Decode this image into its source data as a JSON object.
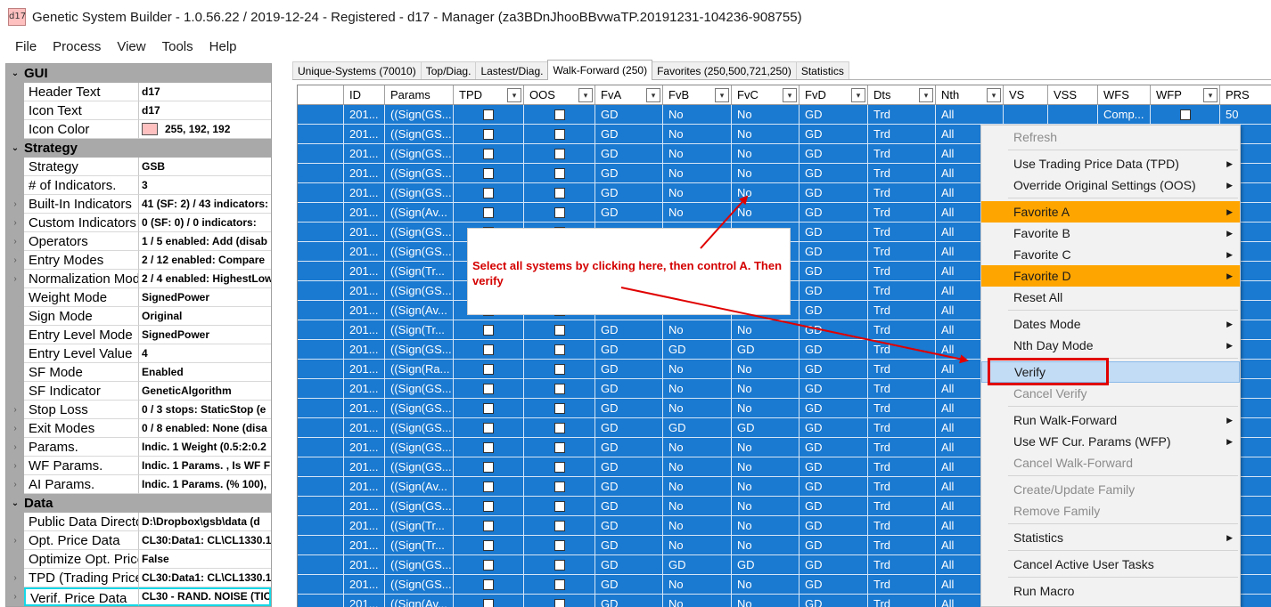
{
  "window": {
    "icon_text": "d17",
    "title": "Genetic System Builder - 1.0.56.22 / 2019-12-24 - Registered - d17 - Manager (za3BDnJhooBBvwaTP.20191231-104236-908755)"
  },
  "menubar": [
    "File",
    "Process",
    "View",
    "Tools",
    "Help"
  ],
  "propgrid": {
    "sections": [
      {
        "title": "GUI",
        "rows": [
          {
            "name": "Header Text",
            "value": "d17"
          },
          {
            "name": "Icon Text",
            "value": "d17"
          },
          {
            "name": "Icon Color",
            "value": "255, 192, 192",
            "swatch": "#ffc0c0"
          }
        ]
      },
      {
        "title": "Strategy",
        "rows": [
          {
            "name": "Strategy",
            "value": "GSB"
          },
          {
            "name": "# of Indicators.",
            "value": "3"
          },
          {
            "name": "Built-In Indicators",
            "value": "41 (SF: 2) / 43 indicators:",
            "expand": true
          },
          {
            "name": "Custom Indicators",
            "value": "0 (SF: 0) / 0 indicators:",
            "expand": true
          },
          {
            "name": "Operators",
            "value": "1 / 5 enabled: Add (disab",
            "expand": true
          },
          {
            "name": "Entry Modes",
            "value": "2 / 12 enabled: Compare",
            "expand": true
          },
          {
            "name": "Normalization Modes",
            "value": "2 / 4 enabled: HighestLow",
            "expand": true
          },
          {
            "name": "Weight Mode",
            "value": "SignedPower"
          },
          {
            "name": "Sign Mode",
            "value": "Original"
          },
          {
            "name": "Entry Level Mode",
            "value": "SignedPower"
          },
          {
            "name": "Entry Level Value",
            "value": "4"
          },
          {
            "name": "SF Mode",
            "value": "Enabled"
          },
          {
            "name": "SF Indicator",
            "value": "GeneticAlgorithm"
          },
          {
            "name": "Stop Loss",
            "value": "0 / 3 stops: StaticStop (e",
            "expand": true
          },
          {
            "name": "Exit Modes",
            "value": "0 / 8 enabled: None (disa",
            "expand": true
          },
          {
            "name": "Params.",
            "value": "Indic. 1 Weight (0.5:2:0.2",
            "expand": true
          },
          {
            "name": "WF Params.",
            "value": "Indic. 1 Params. , Is WF F",
            "expand": true
          },
          {
            "name": "AI Params.",
            "value": "Indic. 1 Params. (% 100),",
            "expand": true
          }
        ]
      },
      {
        "title": "Data",
        "rows": [
          {
            "name": "Public Data Directory",
            "value": "D:\\Dropbox\\gsb\\data (d"
          },
          {
            "name": "Opt. Price Data",
            "value": "CL30:Data1: CL\\CL1330.1",
            "expand": true
          },
          {
            "name": "Optimize Opt. Price",
            "value": "False"
          },
          {
            "name": "TPD (Trading Price",
            "value": "CL30:Data1: CL\\CL1330.1",
            "expand": true
          },
          {
            "name": "Verif. Price Data",
            "value": "CL30 - RAND. NOISE (TICK",
            "expand": true,
            "selected": true
          }
        ]
      }
    ]
  },
  "tabs": [
    {
      "label": "Unique-Systems (70010)",
      "active": false
    },
    {
      "label": "Top/Diag.",
      "active": false
    },
    {
      "label": "Lastest/Diag.",
      "active": false
    },
    {
      "label": "Walk-Forward (250)",
      "active": true
    },
    {
      "label": "Favorites (250,500,721,250)",
      "active": false
    },
    {
      "label": "Statistics",
      "active": false
    }
  ],
  "grid": {
    "columns": [
      {
        "key": "rowhdr",
        "label": ""
      },
      {
        "key": "id",
        "label": "ID"
      },
      {
        "key": "params",
        "label": "Params"
      },
      {
        "key": "tpd",
        "label": "TPD",
        "dropdown": true
      },
      {
        "key": "oos",
        "label": "OOS",
        "dropdown": true
      },
      {
        "key": "fva",
        "label": "FvA",
        "dropdown": true
      },
      {
        "key": "fvb",
        "label": "FvB",
        "dropdown": true
      },
      {
        "key": "fvc",
        "label": "FvC",
        "dropdown": true
      },
      {
        "key": "fvd",
        "label": "FvD",
        "dropdown": true
      },
      {
        "key": "dts",
        "label": "Dts",
        "dropdown": true
      },
      {
        "key": "nth",
        "label": "Nth",
        "dropdown": true
      },
      {
        "key": "vs",
        "label": "VS"
      },
      {
        "key": "vss",
        "label": "VSS"
      },
      {
        "key": "wfs",
        "label": "WFS"
      },
      {
        "key": "wfp",
        "label": "WFP",
        "dropdown": true
      },
      {
        "key": "prs",
        "label": "PRS"
      }
    ],
    "rows": [
      {
        "id": "201...",
        "params": "((Sign(GS...",
        "fva": "GD",
        "fvb": "No",
        "fvc": "No",
        "fvd": "GD",
        "dts": "Trd",
        "nth": "All",
        "wfs": "Comp...",
        "wfp_checkbox": true,
        "prs": "50"
      },
      {
        "id": "201...",
        "params": "((Sign(GS...",
        "fva": "GD",
        "fvb": "No",
        "fvc": "No",
        "fvd": "GD",
        "dts": "Trd",
        "nth": "All"
      },
      {
        "id": "201...",
        "params": "((Sign(GS...",
        "fva": "GD",
        "fvb": "No",
        "fvc": "No",
        "fvd": "GD",
        "dts": "Trd",
        "nth": "All"
      },
      {
        "id": "201...",
        "params": "((Sign(GS...",
        "fva": "GD",
        "fvb": "No",
        "fvc": "No",
        "fvd": "GD",
        "dts": "Trd",
        "nth": "All"
      },
      {
        "id": "201...",
        "params": "((Sign(GS...",
        "fva": "GD",
        "fvb": "No",
        "fvc": "No",
        "fvd": "GD",
        "dts": "Trd",
        "nth": "All"
      },
      {
        "id": "201...",
        "params": "((Sign(Av...",
        "fva": "GD",
        "fvb": "No",
        "fvc": "No",
        "fvd": "GD",
        "dts": "Trd",
        "nth": "All"
      },
      {
        "id": "201...",
        "params": "((Sign(GS...",
        "fva": "",
        "fvb": "",
        "fvc": "",
        "fvd": "GD",
        "dts": "Trd",
        "nth": "All"
      },
      {
        "id": "201...",
        "params": "((Sign(GS...",
        "fva": "",
        "fvb": "",
        "fvc": "",
        "fvd": "GD",
        "dts": "Trd",
        "nth": "All"
      },
      {
        "id": "201...",
        "params": "((Sign(Tr...",
        "fva": "",
        "fvb": "",
        "fvc": "",
        "fvd": "GD",
        "dts": "Trd",
        "nth": "All"
      },
      {
        "id": "201...",
        "params": "((Sign(GS...",
        "fva": "",
        "fvb": "",
        "fvc": "",
        "fvd": "GD",
        "dts": "Trd",
        "nth": "All"
      },
      {
        "id": "201...",
        "params": "((Sign(Av...",
        "fva": "",
        "fvb": "",
        "fvc": "",
        "fvd": "GD",
        "dts": "Trd",
        "nth": "All"
      },
      {
        "id": "201...",
        "params": "((Sign(Tr...",
        "fva": "GD",
        "fvb": "No",
        "fvc": "No",
        "fvd": "GD",
        "dts": "Trd",
        "nth": "All"
      },
      {
        "id": "201...",
        "params": "((Sign(GS...",
        "fva": "GD",
        "fvb": "GD",
        "fvc": "GD",
        "fvd": "GD",
        "dts": "Trd",
        "nth": "All"
      },
      {
        "id": "201...",
        "params": "((Sign(Ra...",
        "fva": "GD",
        "fvb": "No",
        "fvc": "No",
        "fvd": "GD",
        "dts": "Trd",
        "nth": "All"
      },
      {
        "id": "201...",
        "params": "((Sign(GS...",
        "fva": "GD",
        "fvb": "No",
        "fvc": "No",
        "fvd": "GD",
        "dts": "Trd",
        "nth": "All"
      },
      {
        "id": "201...",
        "params": "((Sign(GS...",
        "fva": "GD",
        "fvb": "No",
        "fvc": "No",
        "fvd": "GD",
        "dts": "Trd",
        "nth": "All"
      },
      {
        "id": "201...",
        "params": "((Sign(GS...",
        "fva": "GD",
        "fvb": "GD",
        "fvc": "GD",
        "fvd": "GD",
        "dts": "Trd",
        "nth": "All"
      },
      {
        "id": "201...",
        "params": "((Sign(GS...",
        "fva": "GD",
        "fvb": "No",
        "fvc": "No",
        "fvd": "GD",
        "dts": "Trd",
        "nth": "All"
      },
      {
        "id": "201...",
        "params": "((Sign(GS...",
        "fva": "GD",
        "fvb": "No",
        "fvc": "No",
        "fvd": "GD",
        "dts": "Trd",
        "nth": "All"
      },
      {
        "id": "201...",
        "params": "((Sign(Av...",
        "fva": "GD",
        "fvb": "No",
        "fvc": "No",
        "fvd": "GD",
        "dts": "Trd",
        "nth": "All"
      },
      {
        "id": "201...",
        "params": "((Sign(GS...",
        "fva": "GD",
        "fvb": "No",
        "fvc": "No",
        "fvd": "GD",
        "dts": "Trd",
        "nth": "All"
      },
      {
        "id": "201...",
        "params": "((Sign(Tr...",
        "fva": "GD",
        "fvb": "No",
        "fvc": "No",
        "fvd": "GD",
        "dts": "Trd",
        "nth": "All"
      },
      {
        "id": "201...",
        "params": "((Sign(Tr...",
        "fva": "GD",
        "fvb": "No",
        "fvc": "No",
        "fvd": "GD",
        "dts": "Trd",
        "nth": "All"
      },
      {
        "id": "201...",
        "params": "((Sign(GS...",
        "fva": "GD",
        "fvb": "GD",
        "fvc": "GD",
        "fvd": "GD",
        "dts": "Trd",
        "nth": "All"
      },
      {
        "id": "201...",
        "params": "((Sign(GS...",
        "fva": "GD",
        "fvb": "No",
        "fvc": "No",
        "fvd": "GD",
        "dts": "Trd",
        "nth": "All"
      },
      {
        "id": "201...",
        "params": "((Sign(Av...",
        "fva": "GD",
        "fvb": "No",
        "fvc": "No",
        "fvd": "GD",
        "dts": "Trd",
        "nth": "All"
      }
    ]
  },
  "context_menu": {
    "items": [
      {
        "label": "Refresh",
        "disabled": true
      },
      {
        "sep": true
      },
      {
        "label": "Use Trading Price Data (TPD)",
        "submenu": true
      },
      {
        "label": "Override Original Settings (OOS)",
        "submenu": true
      },
      {
        "sep": true
      },
      {
        "label": "Favorite A",
        "submenu": true,
        "highlight": "orange"
      },
      {
        "label": "Favorite B",
        "submenu": true
      },
      {
        "label": "Favorite C",
        "submenu": true
      },
      {
        "label": "Favorite D",
        "submenu": true,
        "highlight": "orange"
      },
      {
        "label": "Reset All"
      },
      {
        "sep": true
      },
      {
        "label": "Dates Mode",
        "submenu": true
      },
      {
        "label": "Nth Day Mode",
        "submenu": true
      },
      {
        "sep": true
      },
      {
        "label": "Verify",
        "highlight": "blue"
      },
      {
        "label": "Cancel Verify",
        "disabled": true
      },
      {
        "sep": true
      },
      {
        "label": "Run Walk-Forward",
        "submenu": true
      },
      {
        "label": "Use WF Cur. Params (WFP)",
        "submenu": true
      },
      {
        "label": "Cancel Walk-Forward",
        "disabled": true
      },
      {
        "sep": true
      },
      {
        "label": "Create/Update Family",
        "disabled": true
      },
      {
        "label": "Remove Family",
        "disabled": true
      },
      {
        "sep": true
      },
      {
        "label": "Statistics",
        "submenu": true
      },
      {
        "sep": true
      },
      {
        "label": "Cancel Active User Tasks"
      },
      {
        "sep": true
      },
      {
        "label": "Run Macro"
      }
    ]
  },
  "annotation": {
    "text": "Select all systems by clicking here, then control A. Then verify",
    "color": "#d40000"
  }
}
